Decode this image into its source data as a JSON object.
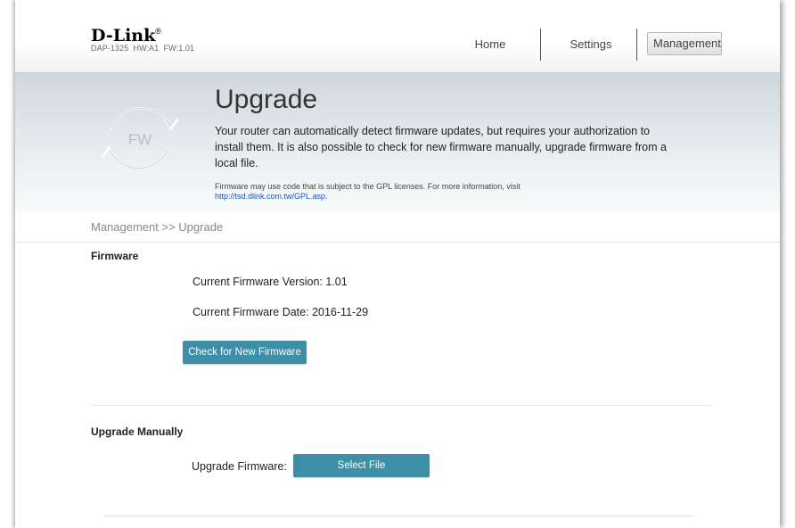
{
  "header": {
    "logo": "D-Link",
    "logo_mark": "®",
    "model": "DAP-1325",
    "hw": "HW:A1",
    "fw": "FW:1.01",
    "nav": [
      {
        "label": "Home"
      },
      {
        "label": "Settings"
      },
      {
        "label": "Management"
      }
    ]
  },
  "banner": {
    "icon_label": "FW",
    "title": "Upgrade",
    "description": "Your router can automatically detect firmware updates, but requires your authorization to install them. It is also possible to check for new firmware manually, upgrade firmware from a local file.",
    "note": "Firmware may use code that is subject to the GPL licenses. For more information, visit",
    "note_link": "http://tsd.dlink.com.tw/GPL.asp."
  },
  "breadcrumb": "Management >> Upgrade",
  "firmware": {
    "title": "Firmware",
    "version_label": "Current Firmware Version:",
    "version": "1.01",
    "date_label": "Current Firmware Date:",
    "date": "2016-11-29",
    "check_button": "Check for New Firmware"
  },
  "manual": {
    "title": "Upgrade Manually",
    "label": "Upgrade Firmware:",
    "select_button": "Select File"
  },
  "colors": {
    "button": "#3c8fa6",
    "link": "#1a55b6"
  }
}
